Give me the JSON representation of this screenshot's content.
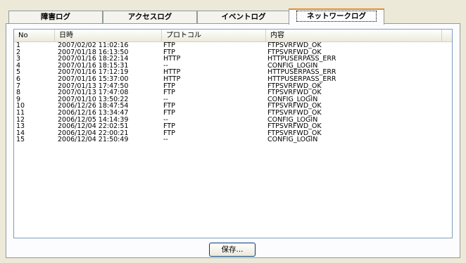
{
  "tabs": [
    {
      "label": "障害ログ"
    },
    {
      "label": "アクセスログ"
    },
    {
      "label": "イベントログ"
    },
    {
      "label": "ネットワークログ"
    }
  ],
  "active_tab": "ネットワークログ",
  "list": {
    "columns": [
      "No",
      "日時",
      "プロトコル",
      "内容"
    ],
    "rows": [
      [
        "1",
        "2007/02/02 11:02:16",
        "FTP",
        "FTPSVRFWD_OK"
      ],
      [
        "2",
        "2007/01/18 16:13:50",
        "FTP",
        "FTPSVRFWD_OK"
      ],
      [
        "3",
        "2007/01/16 18:22:14",
        "HTTP",
        "HTTPUSERPASS_ERR"
      ],
      [
        "4",
        "2007/01/16 18:15:31",
        "--",
        "CONFIG_LOGIN"
      ],
      [
        "5",
        "2007/01/16 17:12:19",
        "HTTP",
        "HTTPUSERPASS_ERR"
      ],
      [
        "6",
        "2007/01/16 15:37:00",
        "HTTP",
        "HTTPUSERPASS_ERR"
      ],
      [
        "7",
        "2007/01/13 17:47:50",
        "FTP",
        "FTPSVRFWD_OK"
      ],
      [
        "8",
        "2007/01/13 17:47:08",
        "FTP",
        "FTPSVRFWD_OK"
      ],
      [
        "9",
        "2007/01/10 13:50:22",
        "--",
        "CONFIG_LOGIN"
      ],
      [
        "10",
        "2006/12/26 18:47:54",
        "FTP",
        "FTPSVRFWD_OK"
      ],
      [
        "11",
        "2006/12/16 13:34:47",
        "FTP",
        "FTPSVRFWD_OK"
      ],
      [
        "12",
        "2006/12/05 14:14:39",
        "--",
        "CONFIG_LOGIN"
      ],
      [
        "13",
        "2006/12/04 22:02:51",
        "FTP",
        "FTPSVRFWD_OK"
      ],
      [
        "14",
        "2006/12/04 22:00:21",
        "FTP",
        "FTPSVRFWD_OK"
      ],
      [
        "15",
        "2006/12/04 21:50:49",
        "--",
        "CONFIG_LOGIN"
      ]
    ]
  },
  "save_button_label": "保存..."
}
